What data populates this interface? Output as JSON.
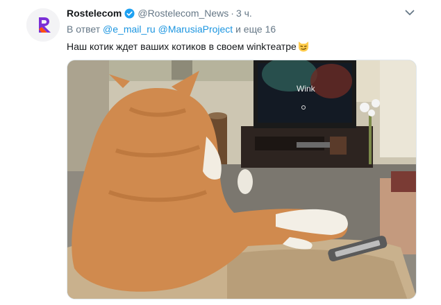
{
  "tweet": {
    "author_name": "Rostelecom",
    "author_handle": "@Rostelecom_News",
    "separator": "·",
    "time": "3 ч.",
    "reply_prefix": "В ответ",
    "reply_mention_1": "@e_mail_ru",
    "reply_mention_2": "@MarusiaProject",
    "reply_suffix": "и еще 16",
    "text": "Наш котик ждет ваших котиков в своем winkтеатре",
    "emoji": "smirking-cat-emoji"
  },
  "media": {
    "tv_screen_text": "Wink"
  },
  "colors": {
    "accent": "#1b95e0",
    "muted": "#657786",
    "text": "#14171a",
    "brand": "#7b2fd6"
  }
}
